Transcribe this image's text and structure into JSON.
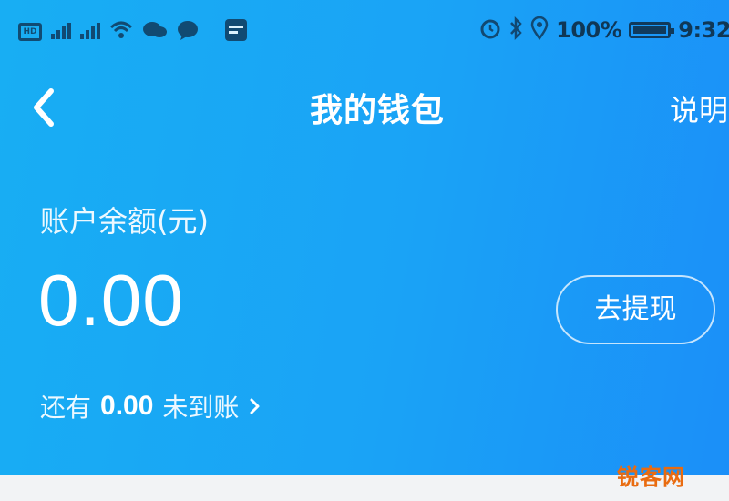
{
  "status_bar": {
    "left_icons": [
      "hd-icon",
      "signal-4g-icon",
      "signal-4g-icon",
      "wifi-icon",
      "chat-icon",
      "message-icon",
      "app-icon"
    ],
    "right_icons": [
      "alarm-icon",
      "bluetooth-icon",
      "location-icon"
    ],
    "battery_text": "100%",
    "time": "9:32"
  },
  "header": {
    "title": "我的钱包",
    "help_label": "说明"
  },
  "balance": {
    "label": "账户余额(元)",
    "amount": "0.00",
    "withdraw_label": "去提现",
    "pending_prefix": "还有",
    "pending_amount": "0.00",
    "pending_suffix": "未到账"
  },
  "watermark": "锐客网",
  "colors": {
    "hero_start": "#18aef3",
    "hero_end": "#1b8ff8",
    "watermark": "#e96b10"
  }
}
